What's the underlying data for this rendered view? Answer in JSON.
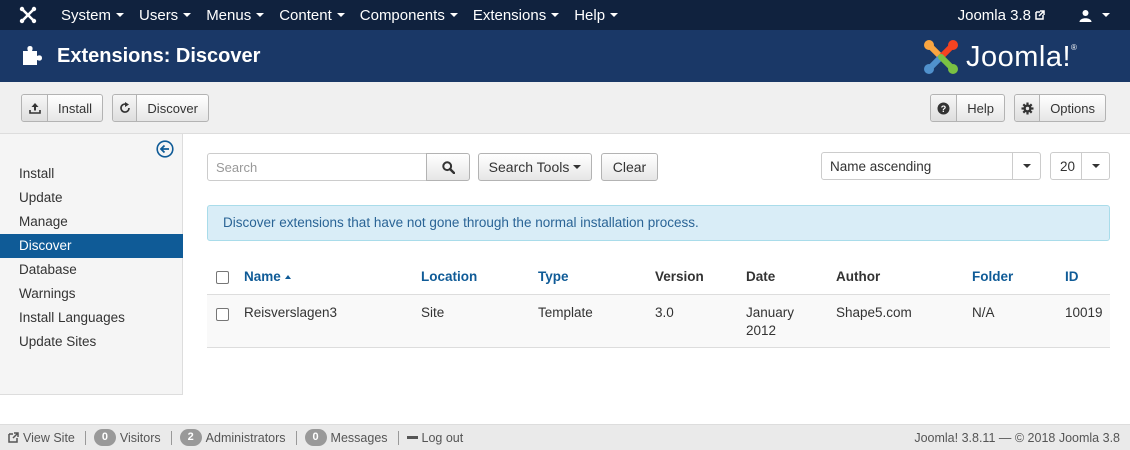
{
  "navbar": {
    "menu": [
      "System",
      "Users",
      "Menus",
      "Content",
      "Components",
      "Extensions",
      "Help"
    ],
    "site_name": "Joomla 3.8"
  },
  "header": {
    "title": "Extensions: Discover",
    "brand": "Joomla!",
    "brand_mark": "®"
  },
  "toolbar": {
    "install_label": "Install",
    "discover_label": "Discover",
    "help_label": "Help",
    "options_label": "Options"
  },
  "sidebar": {
    "items": [
      {
        "label": "Install",
        "active": false
      },
      {
        "label": "Update",
        "active": false
      },
      {
        "label": "Manage",
        "active": false
      },
      {
        "label": "Discover",
        "active": true
      },
      {
        "label": "Database",
        "active": false
      },
      {
        "label": "Warnings",
        "active": false
      },
      {
        "label": "Install Languages",
        "active": false
      },
      {
        "label": "Update Sites",
        "active": false
      }
    ]
  },
  "filters": {
    "search_placeholder": "Search",
    "search_tools_label": "Search Tools",
    "clear_label": "Clear",
    "ordering": "Name ascending",
    "limit": "20"
  },
  "alert": {
    "message": "Discover extensions that have not gone through the normal installation process."
  },
  "table": {
    "headers": {
      "name": "Name",
      "location": "Location",
      "type": "Type",
      "version": "Version",
      "date": "Date",
      "author": "Author",
      "folder": "Folder",
      "id": "ID"
    },
    "rows": [
      {
        "name": "Reisverslagen3",
        "location": "Site",
        "type": "Template",
        "version": "3.0",
        "date_line1": "January",
        "date_line2": "2012",
        "author": "Shape5.com",
        "folder": "N/A",
        "id": "10019"
      }
    ]
  },
  "statusbar": {
    "view_site": "View Site",
    "visitors_count": "0",
    "visitors_label": "Visitors",
    "admins_count": "2",
    "admins_label": "Administrators",
    "messages_count": "0",
    "messages_label": "Messages",
    "logout": "Log out",
    "version": "Joomla! 3.8.11",
    "copyright": "— © 2018 Joomla 3.8"
  },
  "colors": {
    "navbar": "#10223e",
    "header": "#1a3867",
    "active": "#0f5b97",
    "link": "#0f5b97",
    "alert_bg": "#d9edf7"
  },
  "icons": [
    "joomla-icon",
    "external-link-icon",
    "user-icon",
    "puzzle-icon",
    "upload-icon",
    "refresh-icon",
    "question-icon",
    "gear-icon",
    "collapse-left-icon",
    "search-icon",
    "minus-icon"
  ]
}
